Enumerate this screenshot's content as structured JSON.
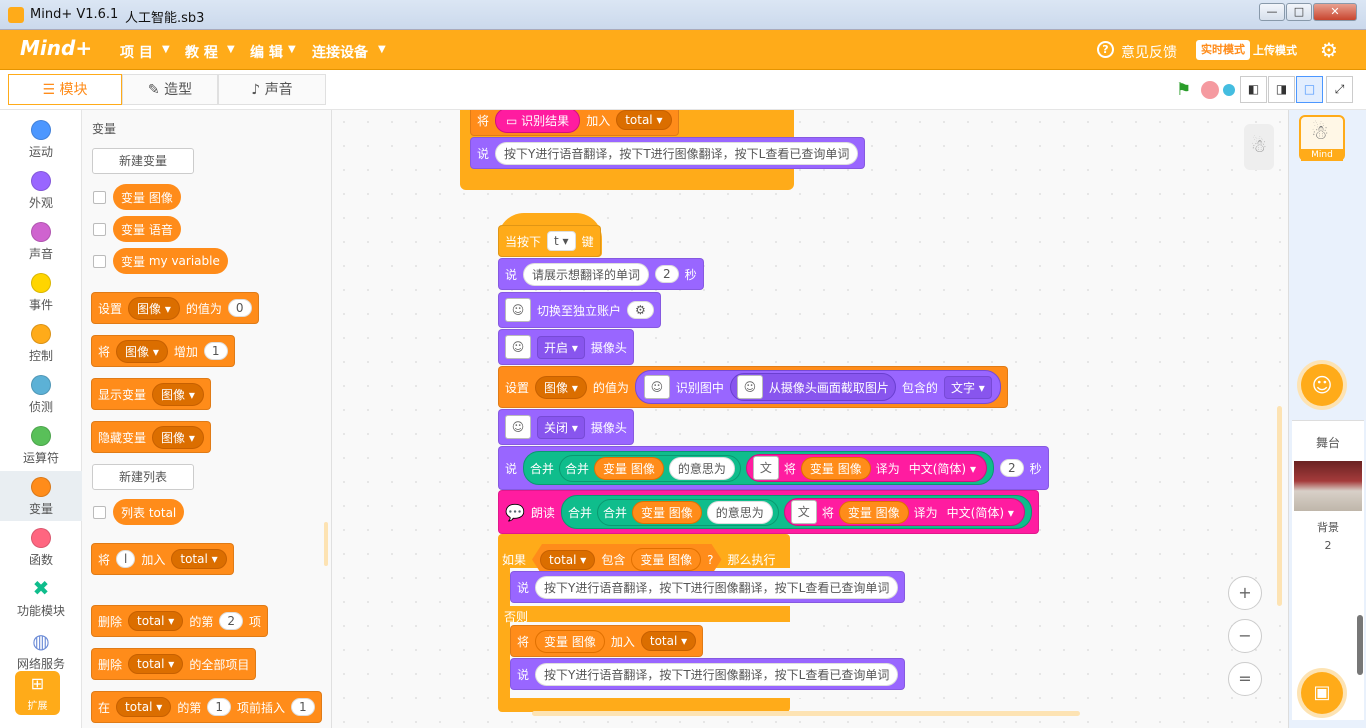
{
  "window": {
    "app_title": "Mind+ V1.6.1",
    "file_title": "人工智能.sb3",
    "minimize": "—",
    "maximize": "□",
    "close": "✕"
  },
  "menubar": {
    "logo": "Mind+",
    "items": [
      "项 目",
      "教 程",
      "编 辑",
      "连接设备"
    ],
    "feedback": "意见反馈",
    "mode_live": "实时模式",
    "mode_upload": "上传模式"
  },
  "tabs": {
    "blocks": "模块",
    "costumes": "造型",
    "sounds": "声音"
  },
  "categories": [
    {
      "label": "运动",
      "color": "#4c97ff"
    },
    {
      "label": "外观",
      "color": "#9966ff"
    },
    {
      "label": "声音",
      "color": "#cf63cf"
    },
    {
      "label": "事件",
      "color": "#ffd500"
    },
    {
      "label": "控制",
      "color": "#ffab19"
    },
    {
      "label": "侦测",
      "color": "#5cb1d6"
    },
    {
      "label": "运算符",
      "color": "#59c059"
    },
    {
      "label": "变量",
      "color": "#ff8c1a"
    },
    {
      "label": "函数",
      "color": "#ff6680"
    },
    {
      "label": "功能模块",
      "color": "#0fbd8c"
    },
    {
      "label": "网络服务",
      "color": "#6b8bd6"
    }
  ],
  "extension_label": "扩展",
  "palette": {
    "heading": "变量",
    "new_variable": "新建变量",
    "var_prefix": "变量",
    "vars": [
      "图像",
      "语音",
      "my variable"
    ],
    "set_label": "设置",
    "set_var": "图像",
    "set_to": "的值为",
    "set_value": "0",
    "change_label": "将",
    "change_var": "图像",
    "change_by": "增加",
    "change_value": "1",
    "show_var": "显示变量",
    "show_var_name": "图像",
    "hide_var": "隐藏变量",
    "hide_var_name": "图像",
    "new_list": "新建列表",
    "list_reporter": "列表 total",
    "add_label": "将",
    "add_value": "l",
    "add_to": "加入",
    "add_list": "total",
    "delete_label": "删除",
    "delete_list": "total",
    "delete_nth": "的第",
    "delete_index": "2",
    "delete_item": "项",
    "delete_all_label": "删除",
    "delete_all_list": "total",
    "delete_all_suffix": "的全部项目",
    "insert_label": "在",
    "insert_list": "total",
    "insert_nth": "的第",
    "insert_index": "1",
    "insert_before": "项前插入",
    "insert_value": "1"
  },
  "script": {
    "top_add": {
      "label": "将",
      "value": "识别结果",
      "to": "加入",
      "list": "total"
    },
    "top_say": {
      "label": "说",
      "text": "按下Y进行语音翻译，按下T进行图像翻译，按下L查看已查询单词"
    },
    "hat": {
      "label": "当按下",
      "key": "t",
      "suffix": "键"
    },
    "say1": {
      "label": "说",
      "text": "请展示想翻译的单词",
      "secs": "2",
      "unit": "秒"
    },
    "switch": {
      "label": "切换至独立账户"
    },
    "cam_on": {
      "value": "开启",
      "suffix": "摄像头"
    },
    "set_var": {
      "label": "设置",
      "var": "图像",
      "to": "的值为",
      "recognize": "识别图中",
      "capture": "从摄像头画面截取图片",
      "contains": "包含的",
      "kind": "文字"
    },
    "cam_off": {
      "value": "关闭",
      "suffix": "摄像头"
    },
    "say2": {
      "label": "说",
      "join": "合并",
      "var": "变量 图像",
      "meaning": "的意思为",
      "translate": "将",
      "to": "译为",
      "lang": "中文(简体)",
      "secs": "2",
      "unit": "秒"
    },
    "speak": {
      "label": "朗读",
      "join": "合并",
      "var": "变量 图像",
      "meaning": "的意思为",
      "translate": "将",
      "to": "译为",
      "lang": "中文(简体)"
    },
    "if": {
      "label": "如果",
      "list": "total",
      "contains": "包含",
      "var": "变量 图像",
      "q": "?",
      "then": "那么执行",
      "else": "否则"
    },
    "if_say": {
      "label": "说",
      "text": "按下Y进行语音翻译，按下T进行图像翻译，按下L查看已查询单词"
    },
    "else_add": {
      "label": "将",
      "var": "变量 图像",
      "to": "加入",
      "list": "total"
    },
    "else_say": {
      "label": "说",
      "text": "按下Y进行语音翻译，按下T进行图像翻译，按下L查看已查询单词"
    }
  },
  "stage": {
    "sprite_name": "Mind",
    "stage_label": "舞台",
    "backdrop_label": "背景",
    "backdrop_count": "2"
  },
  "zoom": {
    "in": "+",
    "out": "−",
    "reset": "="
  }
}
